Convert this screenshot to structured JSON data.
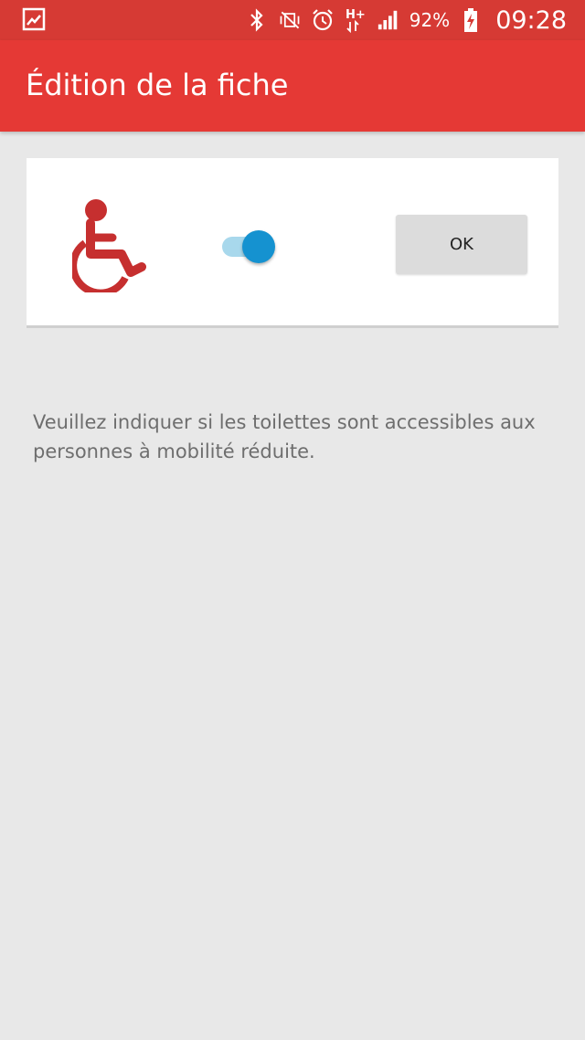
{
  "status_bar": {
    "battery_percent": "92%",
    "time": "09:28",
    "network_type": "H+",
    "icons": [
      "gallery-icon",
      "bluetooth-icon",
      "vibrate-icon",
      "alarm-icon",
      "h-plus-icon",
      "signal-icon",
      "battery-charging-icon"
    ]
  },
  "app_bar": {
    "title": "Édition de la fiche"
  },
  "card": {
    "icon": "wheelchair-icon",
    "toggle_on": true,
    "ok_label": "OK"
  },
  "help_text": "Veuillez indiquer si les toilettes sont accessibles aux personnes à mobilité réduite.",
  "colors": {
    "status_bar": "#d63a34",
    "app_bar": "#e53935",
    "accent_icon": "#c62f2f",
    "switch_thumb": "#1592d0",
    "switch_track": "#a8d8ec",
    "background": "#e8e8e8"
  }
}
